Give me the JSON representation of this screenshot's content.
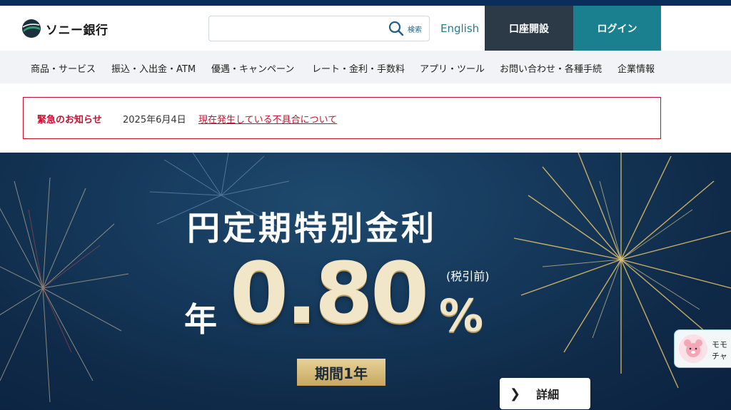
{
  "brand": {
    "name": "ソニー銀行"
  },
  "header": {
    "search_placeholder": "",
    "search_label": "検索",
    "english_link": "English",
    "open_account_label": "口座開設",
    "login_label": "ログイン"
  },
  "nav": {
    "items": [
      {
        "label": "商品・サービス"
      },
      {
        "label": "振込・入出金・ATM"
      },
      {
        "label": "優遇・キャンペーン"
      },
      {
        "label": "レート・金利・手数料"
      },
      {
        "label": "アプリ・ツール"
      },
      {
        "label": "お問い合わせ・各種手続"
      },
      {
        "label": "企業情報"
      }
    ]
  },
  "alert": {
    "title": "緊急のお知らせ",
    "date": "2025年6月4日",
    "link_text": "現在発生している不具合について"
  },
  "hero": {
    "title": "円定期特別金利",
    "year_prefix": "年",
    "rate": "0.80",
    "percent": "%",
    "tax_note": "(税引前)",
    "term": "期間1年",
    "detail_label": "詳細",
    "detail_icon": "chevron-right-icon"
  },
  "chat_widget": {
    "line1": "モモ",
    "line2": "チャ"
  },
  "colors": {
    "topbar": "#0b2d5c",
    "login": "#1a7f8e",
    "open_account": "#2b3a46",
    "alert": "#c8102e",
    "hero_bg": "#15385a",
    "gold": "#e7d29a"
  }
}
